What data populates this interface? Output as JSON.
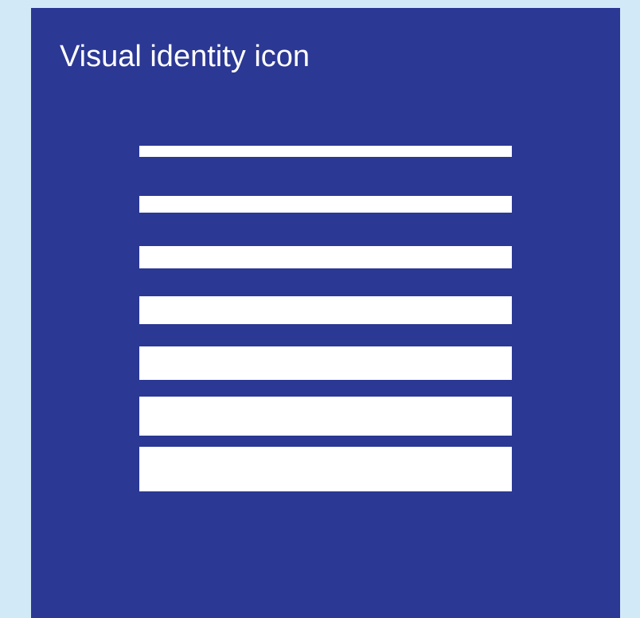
{
  "card": {
    "title": "Visual identity icon"
  },
  "icon": {
    "name": "stacked-bars-icon",
    "bar_count": 7
  },
  "colors": {
    "page_background": "#d2e9f7",
    "card_background": "#2b3894",
    "foreground": "#ffffff"
  }
}
